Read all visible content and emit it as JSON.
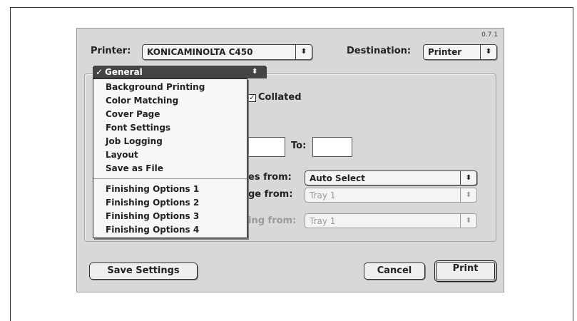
{
  "version": "0.7.1",
  "printer": {
    "label": "Printer:",
    "value": "KONICAMINOLTA C450"
  },
  "destination": {
    "label": "Destination:",
    "value": "Printer"
  },
  "panel_menu": {
    "selected": "General",
    "checkmark": "✓",
    "items": [
      "Background Printing",
      "Color Matching",
      "Cover Page",
      "Font Settings",
      "Job Logging",
      "Layout",
      "Save as File"
    ],
    "finishing_items": [
      "Finishing Options 1",
      "Finishing Options 2",
      "Finishing Options 3",
      "Finishing Options 4"
    ]
  },
  "collated": {
    "label": "Collated",
    "checked": true
  },
  "pages": {
    "to_label": "To:",
    "from_value": "",
    "to_value": ""
  },
  "paper_source": {
    "rows": [
      {
        "label": "es from:",
        "value": "Auto Select",
        "enabled": true
      },
      {
        "label": "ge from:",
        "value": "Tray 1",
        "enabled": false
      },
      {
        "label": "ing from:",
        "value": "Tray 1",
        "enabled": false
      }
    ]
  },
  "buttons": {
    "save_settings": "Save Settings",
    "cancel": "Cancel",
    "print": "Print"
  },
  "icons": {
    "popup_arrows": "updown-arrows-icon",
    "checkmark": "checkmark-icon"
  }
}
